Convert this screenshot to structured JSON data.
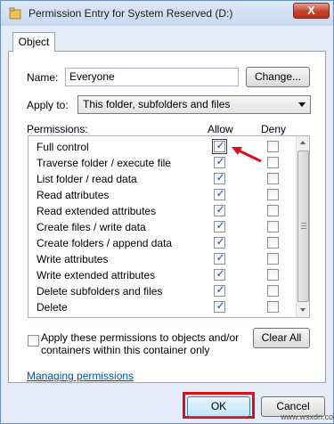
{
  "window": {
    "title": "Permission Entry for System Reserved (D:)",
    "close_label": "X"
  },
  "tabs": [
    {
      "label": "Object"
    }
  ],
  "name_field": {
    "label": "Name:",
    "value": "Everyone",
    "change_button": "Change..."
  },
  "apply_to": {
    "label": "Apply to:",
    "value": "This folder, subfolders and files"
  },
  "permissions": {
    "label": "Permissions:",
    "allow_header": "Allow",
    "deny_header": "Deny",
    "rows": [
      {
        "name": "Full control",
        "allow": true,
        "deny": false
      },
      {
        "name": "Traverse folder / execute file",
        "allow": true,
        "deny": false
      },
      {
        "name": "List folder / read data",
        "allow": true,
        "deny": false
      },
      {
        "name": "Read attributes",
        "allow": true,
        "deny": false
      },
      {
        "name": "Read extended attributes",
        "allow": true,
        "deny": false
      },
      {
        "name": "Create files / write data",
        "allow": true,
        "deny": false
      },
      {
        "name": "Create folders / append data",
        "allow": true,
        "deny": false
      },
      {
        "name": "Write attributes",
        "allow": true,
        "deny": false
      },
      {
        "name": "Write extended attributes",
        "allow": true,
        "deny": false
      },
      {
        "name": "Delete subfolders and files",
        "allow": true,
        "deny": false
      },
      {
        "name": "Delete",
        "allow": true,
        "deny": false
      }
    ]
  },
  "apply_inherit": {
    "label": "Apply these permissions to objects and/or containers within this container only",
    "checked": false
  },
  "clear_all_button": "Clear All",
  "managing_link": "Managing permissions",
  "footer": {
    "ok_label": "OK",
    "cancel_label": "Cancel"
  },
  "colors": {
    "highlight": "#d8121b",
    "link": "#0050b0",
    "check": "#1e4f9c"
  },
  "watermark": "www.wsxdn.com"
}
